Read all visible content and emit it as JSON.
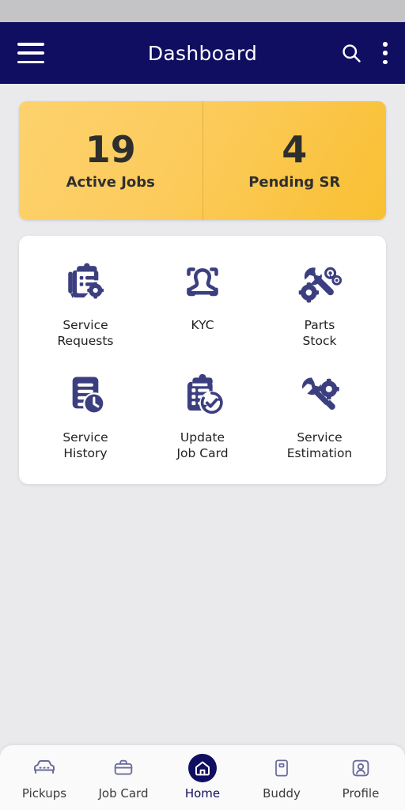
{
  "colors": {
    "status_bar": "#c4c4c6",
    "app_bar": "#100e60",
    "page_background": "#eaeaec",
    "card_background": "#ffffff",
    "stat_gradient_start": "#fdd26d",
    "stat_gradient_end": "#f9c032",
    "icon_indigo": "#3c3f7f",
    "active_nav": "#100e60"
  },
  "app_bar": {
    "title": "Dashboard",
    "menu_icon": "hamburger-menu-icon",
    "search_icon": "search-icon",
    "overflow_icon": "more-vertical-icon"
  },
  "stats": [
    {
      "value": "19",
      "label": "Active Jobs"
    },
    {
      "value": "4",
      "label": "Pending SR"
    }
  ],
  "menu_grid": [
    {
      "label": "Service\nRequests",
      "icon": "clipboard-gear-icon"
    },
    {
      "label": "KYC",
      "icon": "face-scan-icon"
    },
    {
      "label": "Parts\nStock",
      "icon": "wrench-gear-chain-icon"
    },
    {
      "label": "Service\nHistory",
      "icon": "document-clock-icon"
    },
    {
      "label": "Update\nJob Card",
      "icon": "clipboard-refresh-check-icon"
    },
    {
      "label": "Service\nEstimation",
      "icon": "wrench-screwdriver-gear-icon"
    }
  ],
  "bottom_nav": [
    {
      "label": "Pickups",
      "icon": "car-icon",
      "active": false
    },
    {
      "label": "Job Card",
      "icon": "briefcase-icon",
      "active": false
    },
    {
      "label": "Home",
      "icon": "home-icon",
      "active": true
    },
    {
      "label": "Buddy",
      "icon": "id-card-icon",
      "active": false
    },
    {
      "label": "Profile",
      "icon": "person-icon",
      "active": false
    }
  ]
}
